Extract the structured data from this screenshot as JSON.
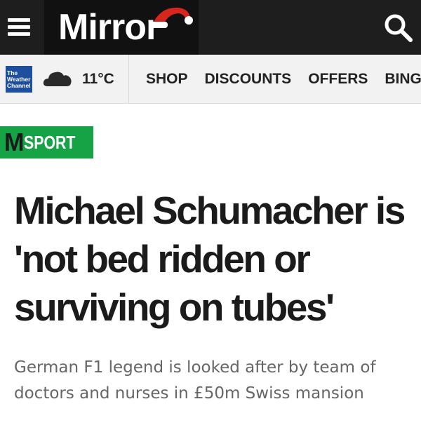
{
  "header": {
    "menu_icon": "hamburger-menu-icon",
    "logo_text": "Mirror",
    "logo_decoration_icon": "santa-hat-icon",
    "search_icon": "search-icon",
    "colors": {
      "bar_background": "#1e1e1e",
      "logo_background": "#111111",
      "hat_red": "#d7261e"
    }
  },
  "weather": {
    "provider_logo_lines": [
      "The",
      "Weather",
      "Channel"
    ],
    "condition_icon": "cloud-icon",
    "temperature": "11°C"
  },
  "nav": {
    "links": [
      {
        "label": "SHOP"
      },
      {
        "label": "DISCOUNTS"
      },
      {
        "label": "OFFERS"
      },
      {
        "label": "BINGO"
      }
    ]
  },
  "section": {
    "logo_letter": "M",
    "label": "SPORT",
    "color": "#15a346"
  },
  "article": {
    "headline_lines": [
      "Michael Schumacher is",
      "'not bed ridden or",
      "surviving on tubes'"
    ],
    "standfirst_lines": [
      "German F1 legend is looked after by team of",
      "doctors and nurses in £50m Swiss mansion"
    ]
  }
}
